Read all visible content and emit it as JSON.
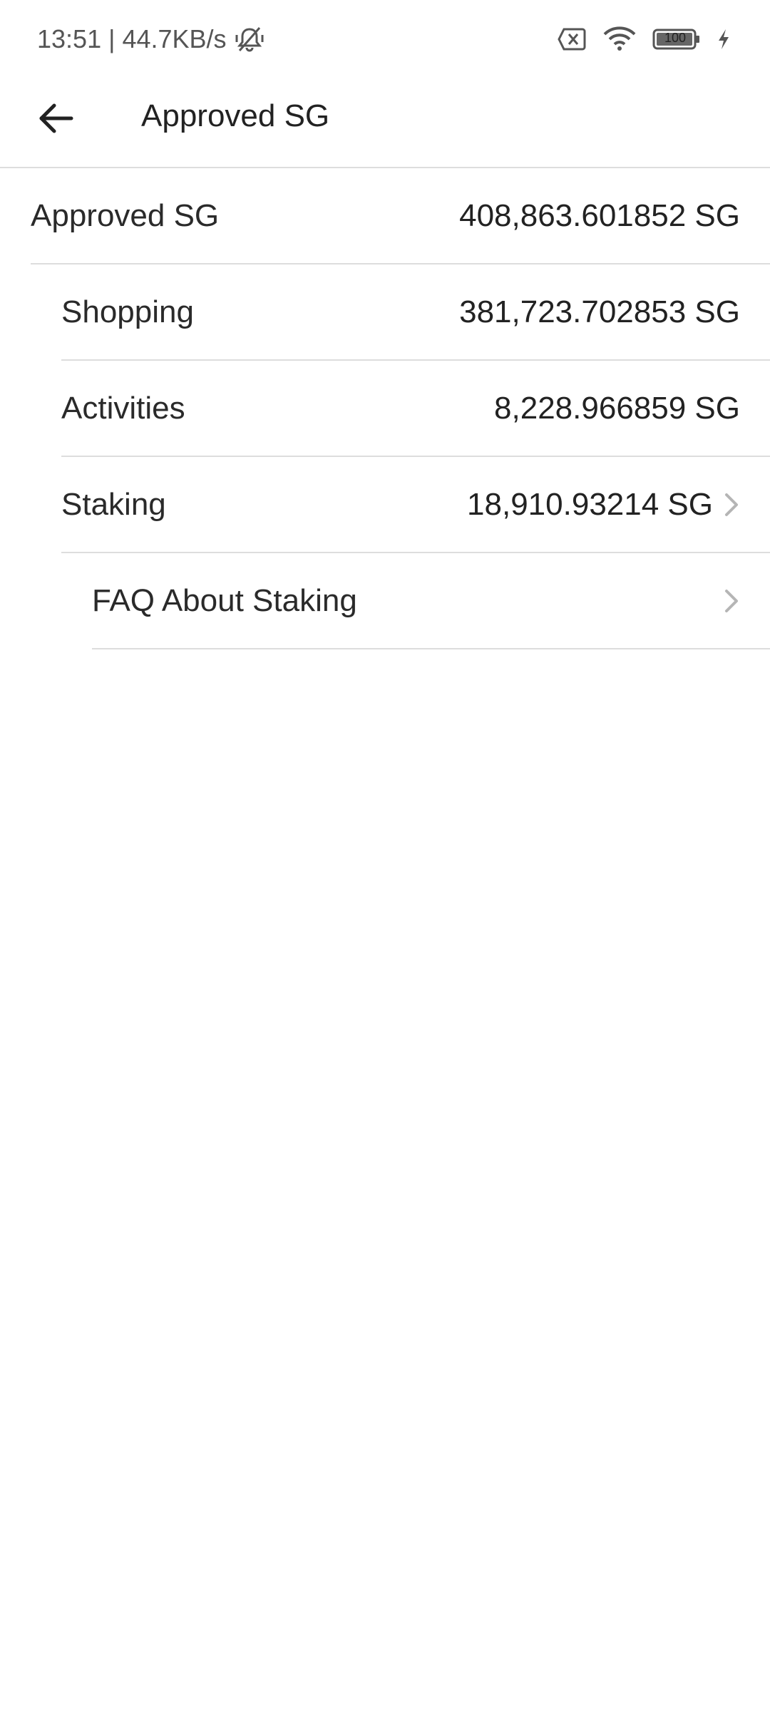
{
  "status_bar": {
    "time": "13:51",
    "separator": "|",
    "speed": "44.7KB/s",
    "battery": "100",
    "icons": [
      "bell-off-icon",
      "sim-none-icon",
      "wifi-icon",
      "battery-icon",
      "charging-icon"
    ]
  },
  "header": {
    "title": "Approved SG",
    "back_icon": "arrow-left-icon"
  },
  "rows": [
    {
      "label": "Approved SG",
      "value": "408,863.601852 SG"
    },
    {
      "label": "Shopping",
      "value": "381,723.702853 SG"
    },
    {
      "label": "Activities",
      "value": "8,228.966859 SG"
    },
    {
      "label": "Staking",
      "value": "18,910.93214 SG"
    },
    {
      "label": "FAQ About Staking"
    }
  ],
  "colors": {
    "text": "#222222",
    "divider": "#dddddd",
    "chevron": "#b5b5b5"
  }
}
